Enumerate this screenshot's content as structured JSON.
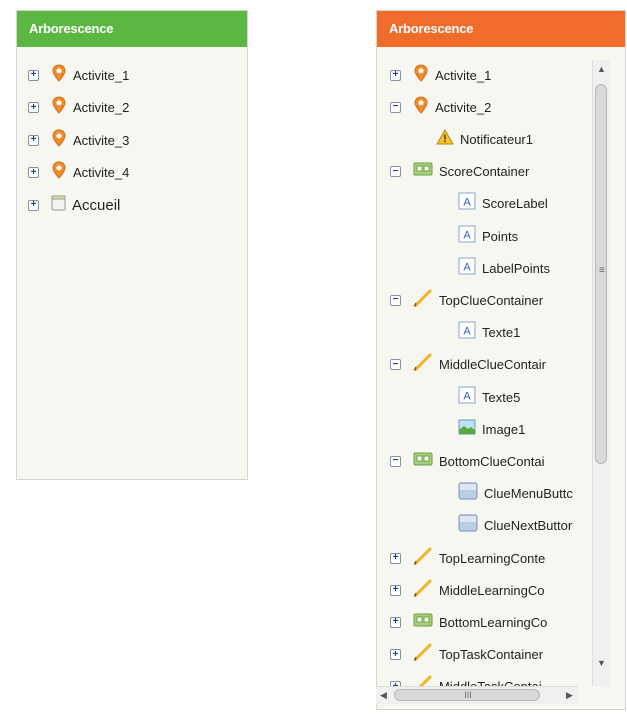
{
  "left_panel": {
    "title": "Arborescence",
    "accent": "#5cb742",
    "items": [
      {
        "label": "Activite_1",
        "toggle": "+",
        "icon": "location-pin-icon"
      },
      {
        "label": "Activite_2",
        "toggle": "+",
        "icon": "location-pin-icon"
      },
      {
        "label": "Activite_3",
        "toggle": "+",
        "icon": "location-pin-icon"
      },
      {
        "label": "Activite_4",
        "toggle": "+",
        "icon": "location-pin-icon"
      },
      {
        "label": "Accueil",
        "toggle": "+",
        "icon": "screen-icon"
      }
    ]
  },
  "right_panel": {
    "title": "Arborescence",
    "accent": "#ef6c2a",
    "items": [
      {
        "label": "Activite_1",
        "toggle": "+",
        "icon": "location-pin-icon"
      },
      {
        "label": "Activite_2",
        "toggle": "−",
        "icon": "location-pin-icon"
      },
      {
        "label": "Notificateur1",
        "toggle": "",
        "icon": "warning-icon"
      },
      {
        "label": "ScoreContainer",
        "toggle": "−",
        "icon": "horizontal-arrangement-icon"
      },
      {
        "label": "ScoreLabel",
        "toggle": "",
        "icon": "label-icon"
      },
      {
        "label": "Points",
        "toggle": "",
        "icon": "label-icon"
      },
      {
        "label": "LabelPoints",
        "toggle": "",
        "icon": "label-icon"
      },
      {
        "label": "TopClueContainer",
        "toggle": "−",
        "icon": "pencil-icon"
      },
      {
        "label": "Texte1",
        "toggle": "",
        "icon": "label-icon"
      },
      {
        "label": "MiddleClueContair",
        "toggle": "−",
        "icon": "pencil-icon"
      },
      {
        "label": "Texte5",
        "toggle": "",
        "icon": "label-icon"
      },
      {
        "label": "Image1",
        "toggle": "",
        "icon": "image-icon"
      },
      {
        "label": "BottomClueContai",
        "toggle": "−",
        "icon": "horizontal-arrangement-icon"
      },
      {
        "label": "ClueMenuButtc",
        "toggle": "",
        "icon": "button-icon"
      },
      {
        "label": "ClueNextButtor",
        "toggle": "",
        "icon": "button-icon"
      },
      {
        "label": "TopLearningConte",
        "toggle": "+",
        "icon": "pencil-icon"
      },
      {
        "label": "MiddleLearningCo",
        "toggle": "+",
        "icon": "pencil-icon"
      },
      {
        "label": "BottomLearningCo",
        "toggle": "+",
        "icon": "horizontal-arrangement-icon"
      },
      {
        "label": "TopTaskContainer",
        "toggle": "+",
        "icon": "pencil-icon"
      },
      {
        "label": "MiddleTaskContai",
        "toggle": "+",
        "icon": "pencil-icon"
      }
    ],
    "scrollbar": {
      "h_thumb_grip": "III",
      "v_thumb_grip": "≡"
    }
  }
}
